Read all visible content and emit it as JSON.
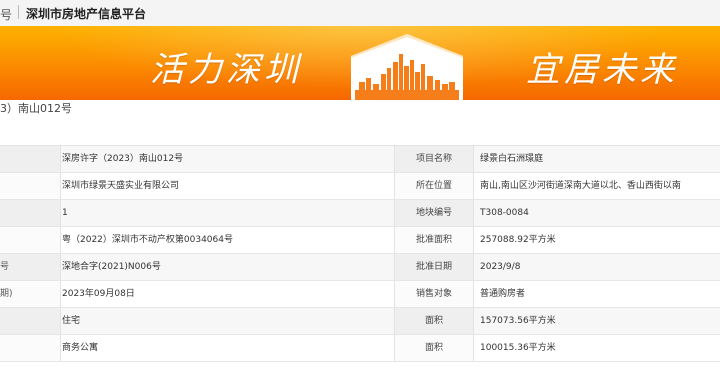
{
  "topbar": {
    "crumb": "号",
    "title": "深圳市房地产信息平台"
  },
  "banner": {
    "slogan_left": "活力深圳",
    "slogan_right": "宜居未来",
    "colors": {
      "top": "#fdb200",
      "mid": "#fb8a00",
      "bottom": "#f56700"
    }
  },
  "cert_line": "3）南山012号",
  "rows": [
    {
      "left_label": "",
      "left_value": "深房许字（2023）南山012号",
      "right_label": "项目名称",
      "right_value": "绿景白石洲璟庭"
    },
    {
      "left_label": "",
      "left_value": "深圳市绿景天盛实业有限公司",
      "right_label": "所在位置",
      "right_value": "南山,南山区沙河街道深南大道以北、香山西街以南"
    },
    {
      "left_label": "",
      "left_value": "1",
      "right_label": "地块编号",
      "right_value": "T308-0084"
    },
    {
      "left_label": "",
      "left_value": "粤（2022）深圳市不动产权第0034064号",
      "right_label": "批准面积",
      "right_value": "257088.92平方米"
    },
    {
      "left_label": "号",
      "left_value": "深地合字(2021)N006号",
      "right_label": "批准日期",
      "right_value": "2023/9/8"
    },
    {
      "left_label": "期)",
      "left_value": "2023年09月08日",
      "right_label": "销售对象",
      "right_value": "普通购房者"
    },
    {
      "left_label": "",
      "left_value": "住宅",
      "right_label": "面积",
      "right_value": "157073.56平方米"
    },
    {
      "left_label": "",
      "left_value": "商务公寓",
      "right_label": "面积",
      "right_value": "100015.36平方米"
    }
  ]
}
